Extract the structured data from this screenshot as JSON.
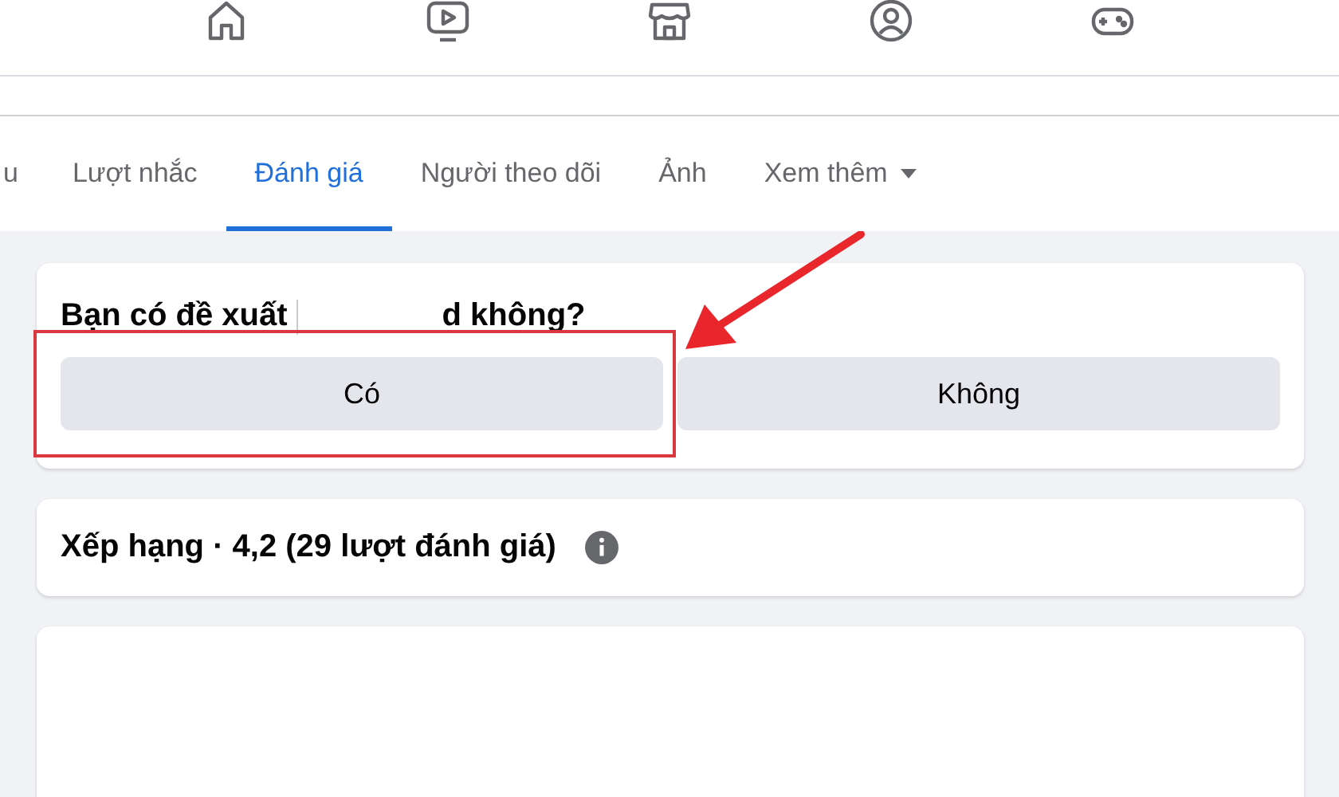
{
  "nav": {
    "items": [
      {
        "kind": "home",
        "selected": false
      },
      {
        "kind": "video",
        "selected": false
      },
      {
        "kind": "store",
        "selected": false
      },
      {
        "kind": "groups",
        "selected": false
      },
      {
        "kind": "gaming",
        "selected": false
      }
    ]
  },
  "tabs": [
    {
      "label": "u",
      "selected": false
    },
    {
      "label": "Lượt nhắc",
      "selected": false
    },
    {
      "label": "Đánh giá",
      "selected": true
    },
    {
      "label": "Người theo dõi",
      "selected": false
    },
    {
      "label": "Ảnh",
      "selected": false
    },
    {
      "label": "Xem thêm",
      "selected": false,
      "dropdown": true
    }
  ],
  "recommend": {
    "question_start": "Bạn có đề xuất",
    "question_end": "d không?",
    "redacted": true,
    "buttons": [
      {
        "label": "Có",
        "highlighted": true
      },
      {
        "label": "Không",
        "highlighted": false
      }
    ]
  },
  "rating": {
    "title": "Xếp hạng · 4,2 (29 lượt đánh giá)"
  },
  "annotation": {
    "arrow": true
  }
}
